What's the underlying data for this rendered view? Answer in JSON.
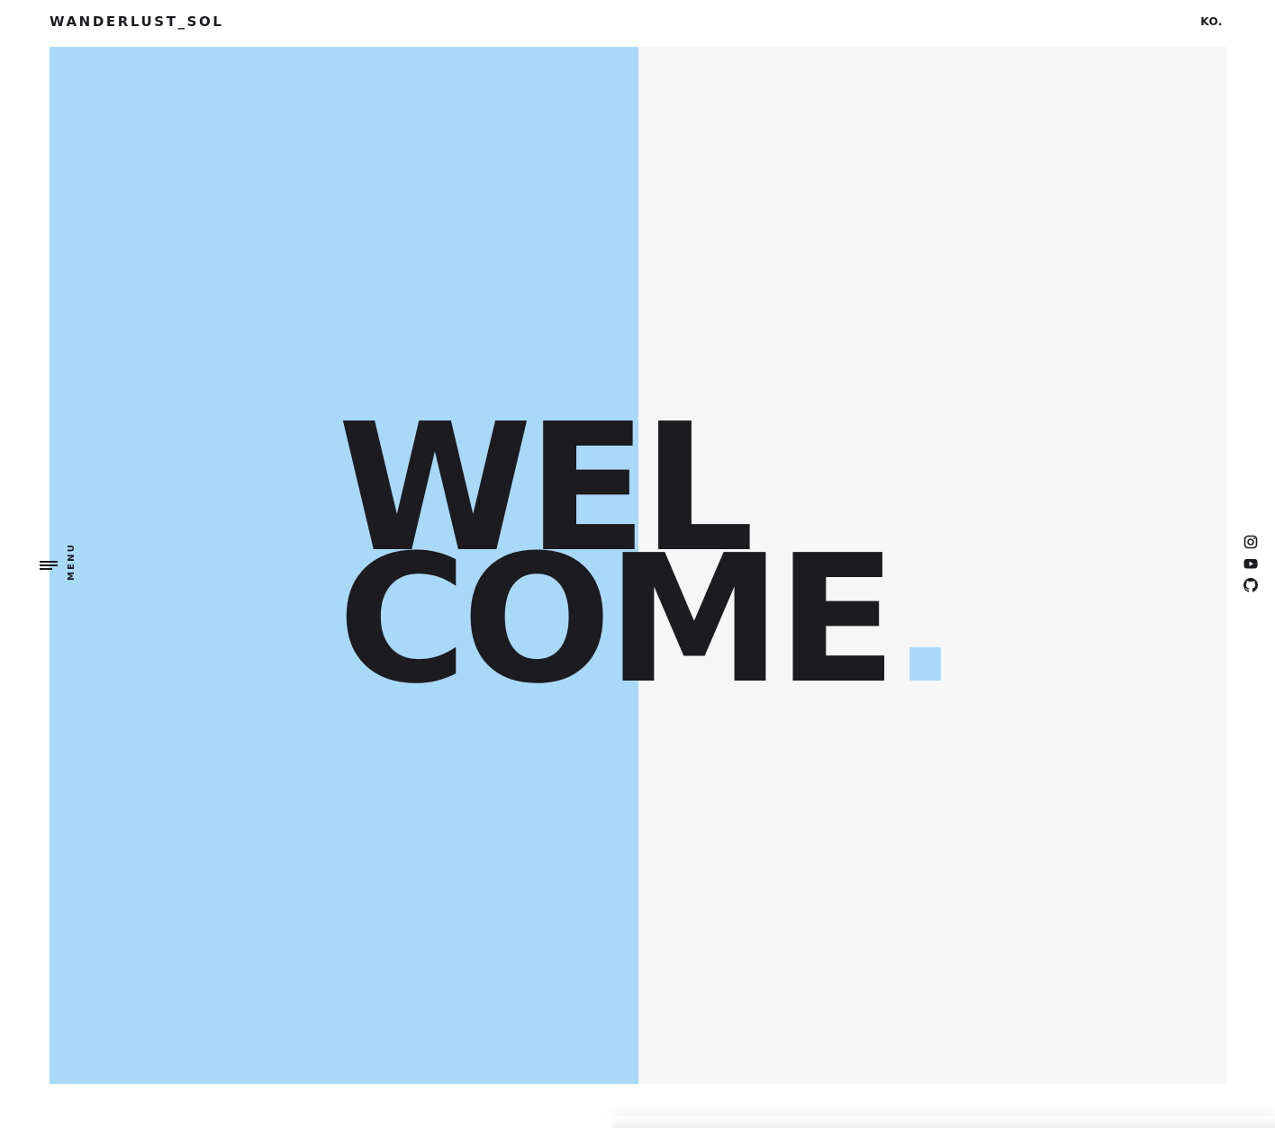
{
  "header": {
    "brand": "WANDERLUST_SOL",
    "language": "KO."
  },
  "hero": {
    "line1": "WEL",
    "line2": "COME",
    "dot": "."
  },
  "menu": {
    "label": "MENU",
    "icon": "hamburger-icon"
  },
  "social": [
    {
      "name": "instagram-icon"
    },
    {
      "name": "youtube-icon"
    },
    {
      "name": "github-icon"
    }
  ],
  "colors": {
    "accent_blue": "#a9d9f8",
    "panel_grey": "#f6f6f6",
    "text_dark": "#1c1b1f"
  }
}
